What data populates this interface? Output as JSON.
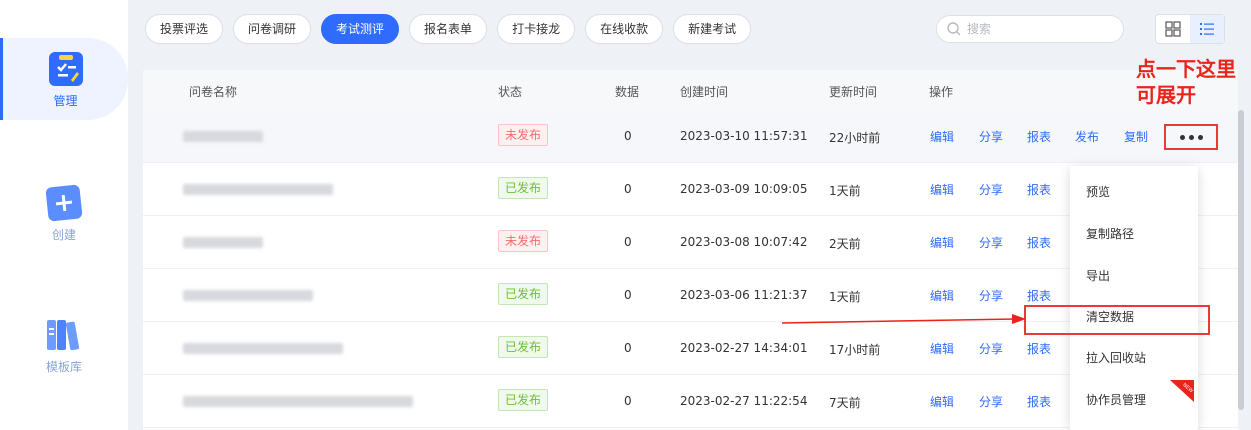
{
  "sidebar": {
    "items": [
      {
        "label": "管理",
        "icon": "clipboard-edit-icon",
        "active": true
      },
      {
        "label": "创建",
        "icon": "plus-folder-icon",
        "active": false
      },
      {
        "label": "模板库",
        "icon": "books-icon",
        "active": false
      }
    ]
  },
  "tabs": [
    "投票评选",
    "问卷调研",
    "考试测评",
    "报名表单",
    "打卡接龙",
    "在线收款",
    "新建考试"
  ],
  "active_tab": "考试测评",
  "search": {
    "placeholder": "搜索"
  },
  "table": {
    "headers": {
      "name": "问卷名称",
      "status": "状态",
      "data": "数据",
      "created": "创建时间",
      "updated": "更新时间",
      "ops": "操作"
    },
    "rows": [
      {
        "status": "未发布",
        "data": "0",
        "created": "2023-03-10 11:57:31",
        "updated": "22小时前"
      },
      {
        "status": "已发布",
        "data": "0",
        "created": "2023-03-09 10:09:05",
        "updated": "1天前"
      },
      {
        "status": "未发布",
        "data": "0",
        "created": "2023-03-08 10:07:42",
        "updated": "2天前"
      },
      {
        "status": "已发布",
        "data": "0",
        "created": "2023-03-06 11:21:37",
        "updated": "1天前"
      },
      {
        "status": "已发布",
        "data": "0",
        "created": "2023-02-27 14:34:01",
        "updated": "17小时前"
      },
      {
        "status": "已发布",
        "data": "0",
        "created": "2023-02-27 11:22:54",
        "updated": "7天前"
      }
    ],
    "ops": {
      "edit": "编辑",
      "share": "分享",
      "report": "报表",
      "publish": "发布",
      "copy": "复制"
    }
  },
  "dropdown": {
    "items": [
      "预览",
      "复制路径",
      "导出",
      "清空数据",
      "拉入回收站",
      "协作员管理"
    ],
    "new_badge": "NEW"
  },
  "annotation": {
    "line1": "点一下这里",
    "line2": "可展开"
  },
  "colors": {
    "primary": "#2f6bff",
    "danger": "#f56c6c",
    "success": "#67c23a",
    "annotation": "#e8241b"
  }
}
